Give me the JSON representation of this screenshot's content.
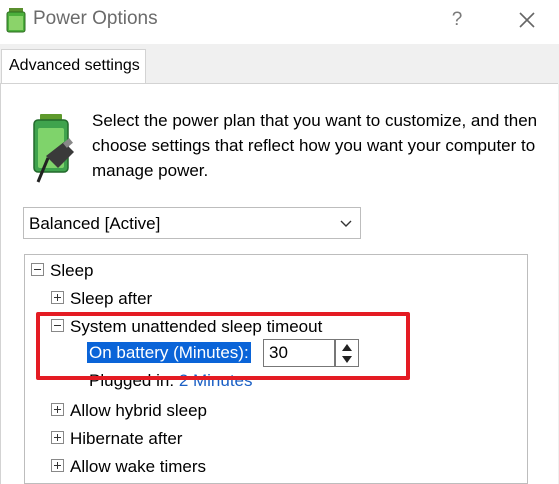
{
  "window": {
    "title": "Power Options",
    "help_glyph": "?",
    "close_glyph": "close-icon"
  },
  "tabs": [
    {
      "label": "Advanced settings",
      "active": true
    }
  ],
  "description": "Select the power plan that you want to customize, and then choose settings that reflect how you want your computer to manage power.",
  "plan_selector": {
    "value": "Balanced [Active]"
  },
  "tree": {
    "items": [
      {
        "label": "Sleep",
        "expanded": true,
        "level": 0
      },
      {
        "label": "Sleep after",
        "expanded": false,
        "level": 1
      },
      {
        "label": "System unattended sleep timeout",
        "expanded": true,
        "level": 1
      },
      {
        "label": "On battery (Minutes):",
        "level": 2,
        "value": "30",
        "selected": true
      },
      {
        "label": "Plugged in:",
        "level": 2,
        "value": "2 Minutes"
      },
      {
        "label": "Allow hybrid sleep",
        "expanded": false,
        "level": 1
      },
      {
        "label": "Hibernate after",
        "expanded": false,
        "level": 1
      },
      {
        "label": "Allow wake timers",
        "expanded": false,
        "level": 1
      }
    ]
  },
  "colors": {
    "selection": "#0a64d8",
    "link": "#1a5fc4",
    "highlight": "#e41b23"
  }
}
